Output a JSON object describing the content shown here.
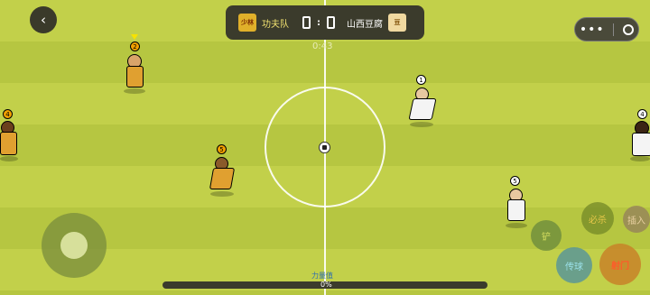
{
  "match": {
    "home_team": "功夫队",
    "away_team": "山西豆腐",
    "home_badge": "少林",
    "away_badge": "豆",
    "home_score": "0",
    "away_score": "0",
    "separator": ":",
    "timer": "0:43"
  },
  "controls": {
    "back_icon": "back-icon",
    "skill_label": "必杀",
    "sub_label": "插入",
    "tackle_label": "铲",
    "pass_label": "传球",
    "shoot_label": "射门",
    "power_label": "力量值",
    "power_value": "0%"
  },
  "players": {
    "orange": [
      {
        "number": "2"
      },
      {
        "number": "4"
      },
      {
        "number": "5"
      }
    ],
    "white": [
      {
        "number": "1"
      },
      {
        "number": "4"
      },
      {
        "number": "5"
      }
    ]
  },
  "colors": {
    "pitch_light": "#c2d04a",
    "pitch_dark": "#b6c641",
    "team_orange": "#e0a030",
    "team_white": "#f4f4f4",
    "hud": "#3b3b2c"
  }
}
